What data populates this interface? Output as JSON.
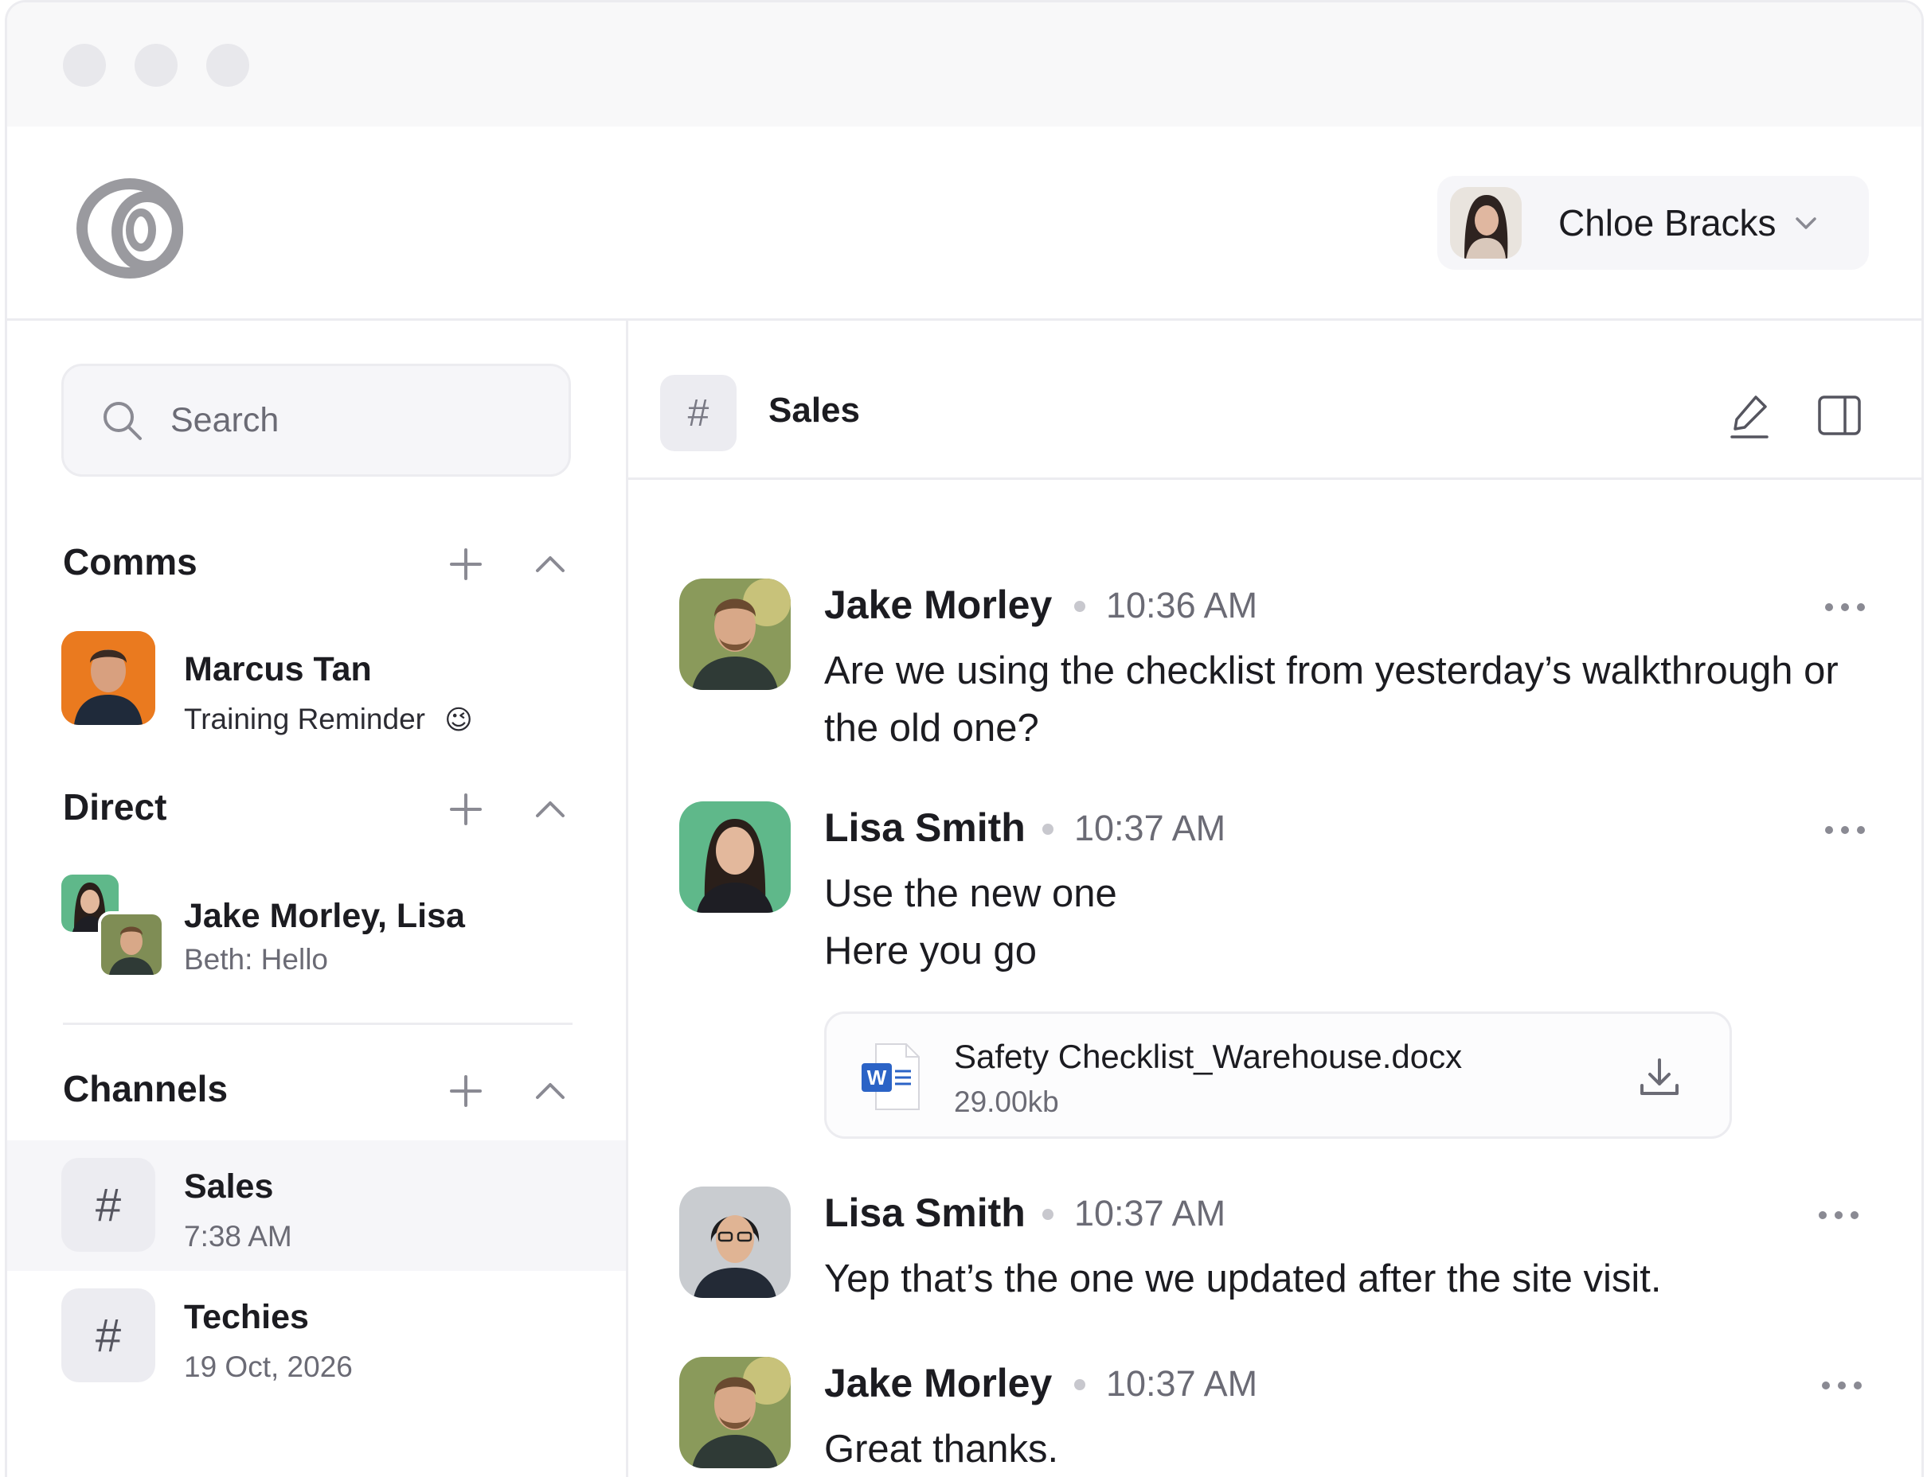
{
  "user_menu": {
    "name": "Chloe Bracks"
  },
  "search": {
    "placeholder": "Search"
  },
  "sections": {
    "comms": {
      "title": "Comms"
    },
    "direct": {
      "title": "Direct"
    },
    "channels": {
      "title": "Channels"
    }
  },
  "comms_items": [
    {
      "name": "Marcus Tan",
      "subtitle": "Training Reminder",
      "emoji": "😉"
    }
  ],
  "direct_items": [
    {
      "name": "Jake Morley, Lisa",
      "subtitle": "Beth: Hello"
    }
  ],
  "channel_items": [
    {
      "symbol": "#",
      "name": "Sales",
      "subtitle": "7:38 AM",
      "active": true
    },
    {
      "symbol": "#",
      "name": "Techies",
      "subtitle": "19 Oct, 2026",
      "active": false
    }
  ],
  "channel_header": {
    "symbol": "#",
    "title": "Sales"
  },
  "messages": [
    {
      "author": "Jake Morley",
      "time": "10:36 AM",
      "lines": [
        "Are we using the checklist from yesterday’s walkthrough or",
        "the old one?"
      ]
    },
    {
      "author": "Lisa Smith",
      "time": "10:37 AM",
      "lines": [
        "Use the new one",
        "Here you go"
      ]
    },
    {
      "author": "Lisa Smith",
      "time": "10:37 AM",
      "lines": [
        "Yep that’s the one we updated after the site visit."
      ]
    },
    {
      "author": "Jake Morley",
      "time": "10:37 AM",
      "lines": [
        "Great thanks."
      ]
    }
  ],
  "attachment": {
    "file_name": "Safety Checklist_Warehouse.docx",
    "file_size": "29.00kb",
    "file_badge": "W"
  },
  "colors": {
    "accent_orange": "#ea7a1f",
    "accent_green": "#5fb88a",
    "word_blue": "#2b63c6",
    "logo_gray": "#9a9a9f"
  },
  "icons": [
    "logo-icon",
    "chevron-down-icon",
    "search-icon",
    "plus-icon",
    "chevron-up-icon",
    "edit-icon",
    "sidebar-toggle-icon",
    "more-icon",
    "word-file-icon",
    "download-icon"
  ]
}
